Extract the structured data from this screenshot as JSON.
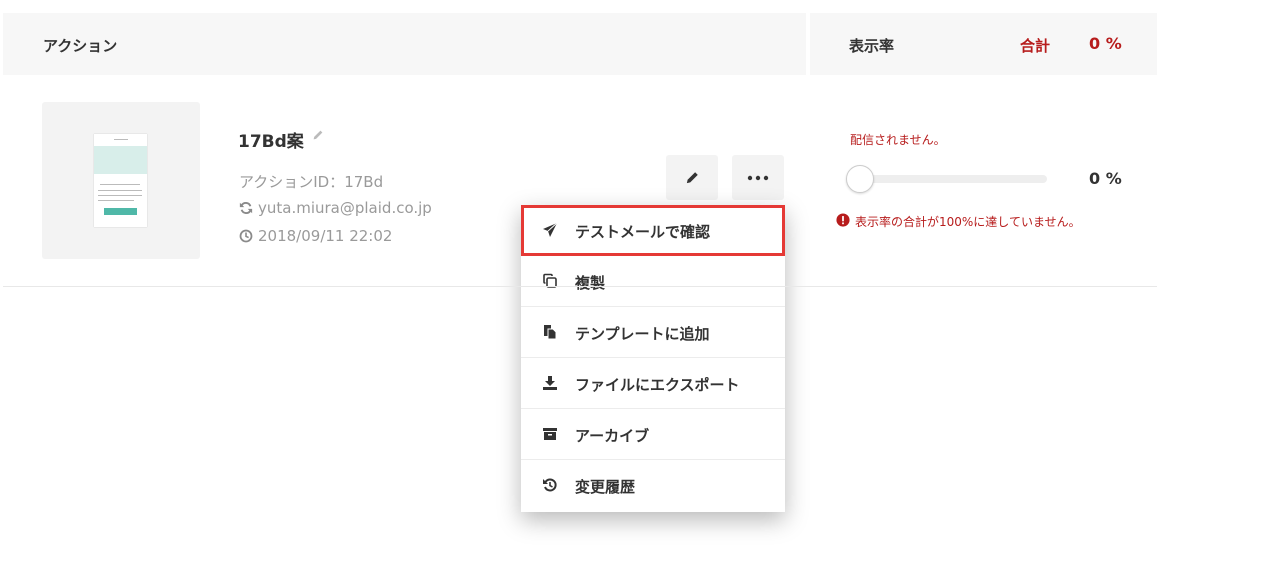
{
  "header": {
    "action_label": "アクション",
    "rate_label": "表示率",
    "total_label": "合計",
    "total_value": "0 %"
  },
  "action": {
    "title": "17Bd案",
    "action_id": "アクションID：17Bd",
    "author": "yuta.miura@plaid.co.jp",
    "datetime": "2018/09/11 22:02"
  },
  "menu": {
    "items": [
      {
        "label": "テストメールで確認",
        "icon": "send-icon"
      },
      {
        "label": "複製",
        "icon": "copy-icon"
      },
      {
        "label": "テンプレートに追加",
        "icon": "template-icon"
      },
      {
        "label": "ファイルにエクスポート",
        "icon": "download-icon"
      },
      {
        "label": "アーカイブ",
        "icon": "archive-icon"
      },
      {
        "label": "変更履歴",
        "icon": "history-icon"
      }
    ]
  },
  "status": {
    "not_delivered": "配信されません。",
    "slider_value": "0 %",
    "slider_fraction": 0,
    "warning": "表示率の合計が100%に達していません。"
  },
  "colors": {
    "accent_red": "#b71c1c",
    "highlight_border": "#e53935",
    "header_bg": "#f7f7f7"
  }
}
